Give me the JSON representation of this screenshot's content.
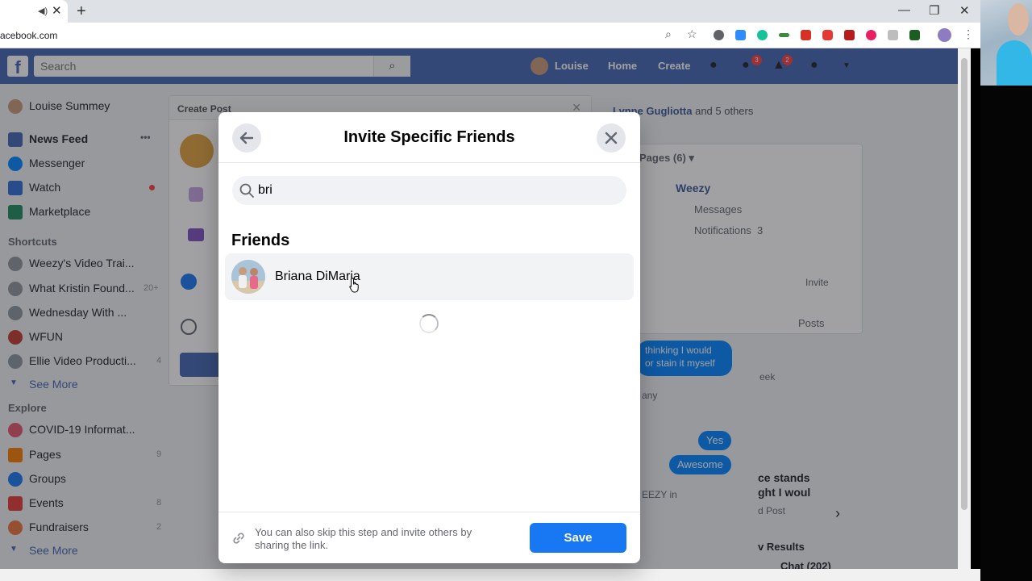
{
  "browser": {
    "url": "acebook.com",
    "tab_sound_glyph": "◀)",
    "tab_close_glyph": "✕",
    "newtab_glyph": "+",
    "minimize_glyph": "—",
    "restore_glyph": "❐",
    "close_glyph": "✕",
    "menu_glyph": "⋮"
  },
  "fb": {
    "logo": "f",
    "search_placeholder": "Search",
    "nav": {
      "profile": "Louise",
      "home": "Home",
      "create": "Create"
    },
    "badges": {
      "messages": "3",
      "notifications": "2"
    },
    "left_nav": {
      "profile": "Louise Summey",
      "items": [
        {
          "label": "News Feed",
          "more": "•••"
        },
        {
          "label": "Messenger"
        },
        {
          "label": "Watch"
        },
        {
          "label": "Marketplace"
        }
      ],
      "shortcuts_heading": "Shortcuts",
      "shortcuts": [
        {
          "label": "Weezy's Video Trai..."
        },
        {
          "label": "What Kristin Found...",
          "count": "20+"
        },
        {
          "label": "Wednesday With ..."
        },
        {
          "label": "WFUN"
        },
        {
          "label": "Ellie Video Producti...",
          "count": "4"
        }
      ],
      "see_more_1": "See More",
      "explore_heading": "Explore",
      "explore": [
        {
          "label": "COVID-19 Informat..."
        },
        {
          "label": "Pages",
          "count": "9"
        },
        {
          "label": "Groups"
        },
        {
          "label": "Events",
          "count": "8"
        },
        {
          "label": "Fundraisers",
          "count": "2"
        }
      ],
      "see_more_2": "See More"
    },
    "create_post": {
      "title": "Create Post",
      "close": "✕"
    },
    "right": {
      "liked_by": "Lynne Gugliotta",
      "liked_others": "and 5 others",
      "pages_label": "Pages (6) ▾",
      "page_name": "Weezy",
      "messages": "Messages",
      "notifications": "Notifications",
      "notifications_count": "3",
      "invite": "Invite",
      "posts_tab": "Posts",
      "chat_partial_1": "thinking I would",
      "chat_partial_2": "or stain it myself",
      "chat_week": "eek",
      "chat_many": "any",
      "chat_yes": "Yes",
      "chat_awesome": "Awesome",
      "story_1": "ce stands",
      "story_2": "ght I woul",
      "story_3": "d Post",
      "weezy_in": "EEZY in",
      "results": "v Results",
      "chat_count": "Chat (202)"
    }
  },
  "modal": {
    "title": "Invite Specific Friends",
    "search_value": "bri",
    "section_title": "Friends",
    "friends": [
      {
        "name": "Briana DiMaria"
      }
    ],
    "footer_text": "You can also skip this step and invite others by sharing the link.",
    "save_label": "Save"
  }
}
